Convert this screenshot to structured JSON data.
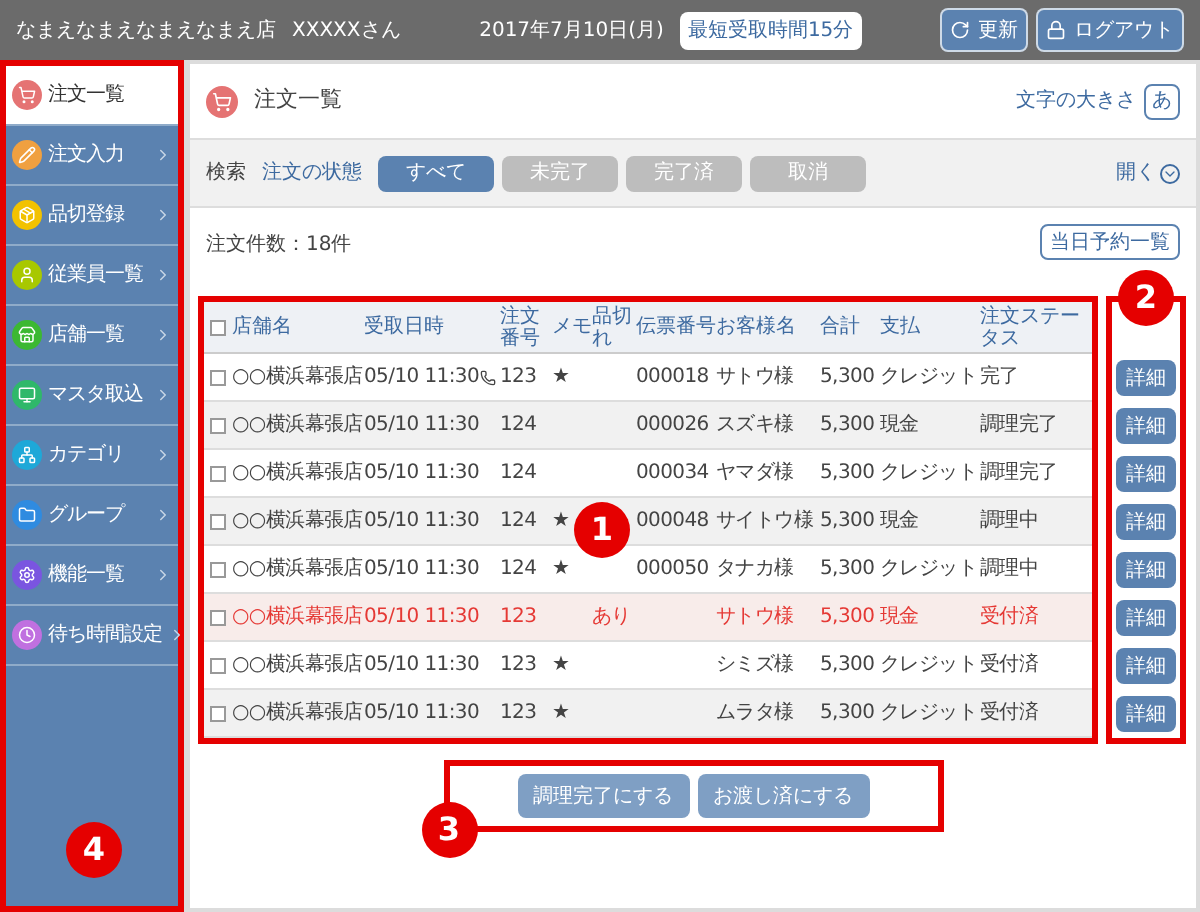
{
  "header": {
    "store": "なまえなまえなまえなまえ店",
    "user": "XXXXXさん",
    "date": "2017年7月10日(月)",
    "pickup": "最短受取時間15分",
    "buttons": [
      {
        "kind": "refresh",
        "label": "更新"
      },
      {
        "kind": "logout",
        "label": "ログアウト"
      }
    ]
  },
  "sidebar": {
    "items": [
      {
        "label": "注文一覧",
        "color": "#e57373",
        "selected": true
      },
      {
        "label": "注文入力",
        "color": "#f0a040",
        "selected": false
      },
      {
        "label": "品切登録",
        "color": "#f2c200",
        "selected": false
      },
      {
        "label": "従業員一覧",
        "color": "#a8c800",
        "selected": false
      },
      {
        "label": "店舗一覧",
        "color": "#3cb832",
        "selected": false
      },
      {
        "label": "マスタ取込",
        "color": "#2fb86a",
        "selected": false
      },
      {
        "label": "カテゴリ",
        "color": "#1ea8d8",
        "selected": false
      },
      {
        "label": "グループ",
        "color": "#2f8be0",
        "selected": false
      },
      {
        "label": "機能一覧",
        "color": "#7a55e0",
        "selected": false
      },
      {
        "label": "待ち時間設定",
        "color": "#c070e0",
        "selected": false
      }
    ]
  },
  "page": {
    "title": "注文一覧",
    "font_size_label": "文字の大きさ",
    "font_size_button": "あ"
  },
  "search": {
    "label": "検索",
    "status_label": "注文の状態",
    "filters": [
      {
        "label": "すべて",
        "selected": true
      },
      {
        "label": "未完了",
        "selected": false
      },
      {
        "label": "完了済",
        "selected": false
      },
      {
        "label": "取消",
        "selected": false
      }
    ],
    "toggle": "開く"
  },
  "count": "注文件数：18件",
  "reservations_button": "当日予約一覧",
  "table": {
    "all_checked": false,
    "columns": [
      "店舗名",
      "受取日時",
      "注文番号",
      "メモ",
      "品切れ",
      "伝票番号",
      "お客様名",
      "合計",
      "支払",
      "注文ステータス"
    ],
    "rows": [
      {
        "checked": false,
        "alert": false,
        "phone": true,
        "store": "○○横浜幕張店",
        "time": "05/10 11:30",
        "order": "123",
        "memo": "★",
        "soldout": "",
        "slip": "000018",
        "customer": "サトウ様",
        "total": "5,300",
        "payment": "クレジット",
        "status": "完了",
        "detail": "詳細"
      },
      {
        "checked": false,
        "alert": false,
        "phone": false,
        "store": "○○横浜幕張店",
        "time": "05/10 11:30",
        "order": "124",
        "memo": "",
        "soldout": "",
        "slip": "000026",
        "customer": "スズキ様",
        "total": "5,300",
        "payment": "現金",
        "status": "調理完了",
        "detail": "詳細"
      },
      {
        "checked": false,
        "alert": false,
        "phone": false,
        "store": "○○横浜幕張店",
        "time": "05/10 11:30",
        "order": "124",
        "memo": "",
        "soldout": "",
        "slip": "000034",
        "customer": "ヤマダ様",
        "total": "5,300",
        "payment": "クレジット",
        "status": "調理完了",
        "detail": "詳細"
      },
      {
        "checked": false,
        "alert": false,
        "phone": false,
        "store": "○○横浜幕張店",
        "time": "05/10 11:30",
        "order": "124",
        "memo": "★",
        "soldout": "",
        "slip": "000048",
        "customer": "サイトウ様",
        "total": "5,300",
        "payment": "現金",
        "status": "調理中",
        "detail": "詳細"
      },
      {
        "checked": false,
        "alert": false,
        "phone": false,
        "store": "○○横浜幕張店",
        "time": "05/10 11:30",
        "order": "124",
        "memo": "★",
        "soldout": "",
        "slip": "000050",
        "customer": "タナカ様",
        "total": "5,300",
        "payment": "クレジット",
        "status": "調理中",
        "detail": "詳細"
      },
      {
        "checked": false,
        "alert": true,
        "phone": false,
        "store": "○○横浜幕張店",
        "time": "05/10 11:30",
        "order": "123",
        "memo": "",
        "soldout": "あり",
        "slip": "",
        "customer": "サトウ様",
        "total": "5,300",
        "payment": "現金",
        "status": "受付済",
        "detail": "詳細"
      },
      {
        "checked": false,
        "alert": false,
        "phone": false,
        "store": "○○横浜幕張店",
        "time": "05/10 11:30",
        "order": "123",
        "memo": "★",
        "soldout": "",
        "slip": "",
        "customer": "シミズ様",
        "total": "5,300",
        "payment": "クレジット",
        "status": "受付済",
        "detail": "詳細"
      },
      {
        "checked": false,
        "alert": false,
        "phone": false,
        "store": "○○横浜幕張店",
        "time": "05/10 11:30",
        "order": "123",
        "memo": "★",
        "soldout": "",
        "slip": "",
        "customer": "ムラタ様",
        "total": "5,300",
        "payment": "クレジット",
        "status": "受付済",
        "detail": "詳細"
      }
    ]
  },
  "actions": [
    {
      "label": "調理完了にする",
      "disabled": true
    },
    {
      "label": "お渡し済にする",
      "disabled": true
    }
  ],
  "annotations": [
    {
      "label": "1"
    },
    {
      "label": "2"
    },
    {
      "label": "3"
    },
    {
      "label": "4"
    }
  ]
}
